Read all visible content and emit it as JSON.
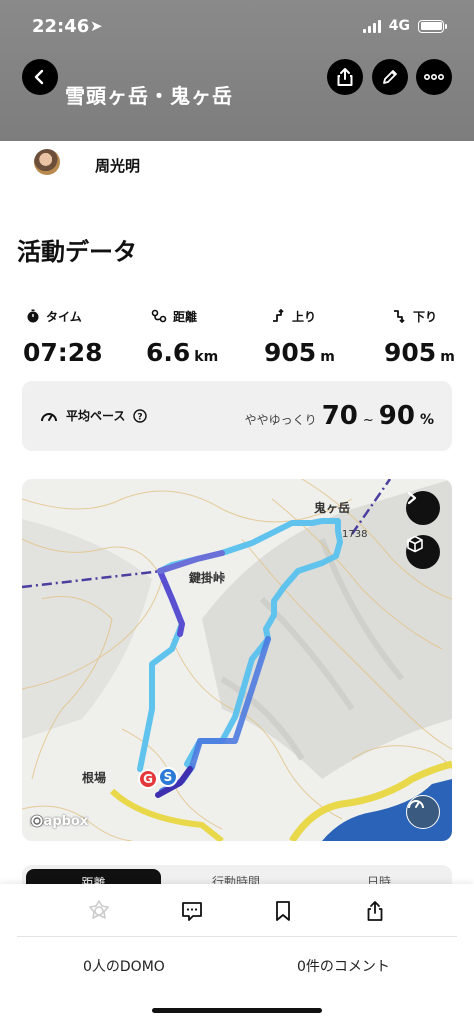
{
  "status_bar": {
    "time": "22:46",
    "network": "4G"
  },
  "header": {
    "title": "雪頭ヶ岳・鬼ヶ岳"
  },
  "user": {
    "name": "周光明"
  },
  "section_title": "活動データ",
  "stats": {
    "time": {
      "label": "タイム",
      "value": "07:28",
      "unit": ""
    },
    "distance": {
      "label": "距離",
      "value": "6.6",
      "unit": "km"
    },
    "ascent": {
      "label": "上り",
      "value": "905",
      "unit": "m"
    },
    "descent": {
      "label": "下り",
      "value": "905",
      "unit": "m"
    }
  },
  "pace": {
    "label": "平均ペース",
    "description": "ややゆっくり",
    "min": "70",
    "separator": "~",
    "max": "90",
    "unit": "%"
  },
  "map": {
    "peak_label": "鬼ヶ岳",
    "pass_label": "鍵掛峠",
    "place_label": "根場",
    "elevation_label": "1738",
    "goal_marker": "G",
    "start_marker": "S",
    "attribution": "mapbox"
  },
  "tabs": {
    "items": [
      "距離",
      "行動時間",
      "日時"
    ]
  },
  "bottom": {
    "domo_count": "0人のDOMO",
    "comment_count": "0件のコメント"
  },
  "colors": {
    "route_dark": "#5b4fd1",
    "route_light": "#5fc3ee",
    "goal": "#e4393c",
    "start": "#2b7bd6"
  }
}
